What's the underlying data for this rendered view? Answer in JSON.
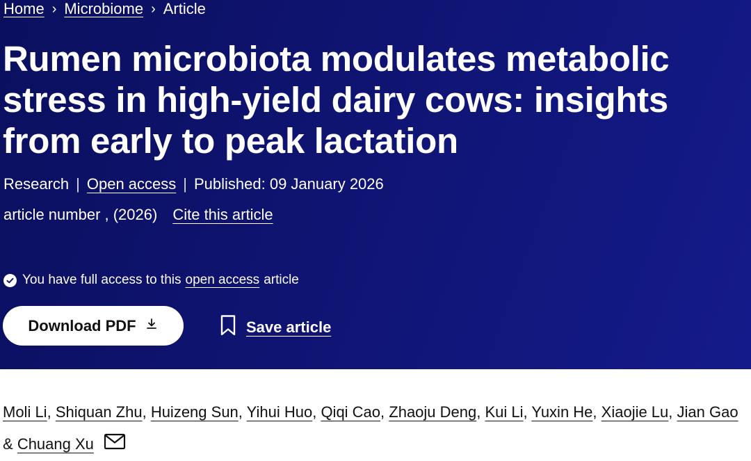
{
  "breadcrumb": {
    "items": [
      "Home",
      "Microbiome"
    ],
    "current": "Article",
    "separator": "›"
  },
  "article": {
    "title": "Rumen microbiota modulates metabolic stress in high-yield dairy cows: insights from early to peak lactation",
    "type": "Research",
    "access_label": "Open access",
    "published": "Published: 09 January 2026",
    "article_number": "article number , (2026)",
    "cite_label": "Cite this article"
  },
  "access_notice": {
    "prefix": "You have full access to this",
    "link": "open access",
    "suffix": "article"
  },
  "actions": {
    "download_label": "Download PDF",
    "save_label": "Save article"
  },
  "authors": {
    "names": [
      "Moli Li",
      "Shiquan Zhu",
      "Huizeng Sun",
      "Yihui Huo",
      "Qiqi Cao",
      "Zhaoju Deng",
      "Kui Li",
      "Yuxin He",
      "Xiaojie Lu",
      "Jian Gao"
    ],
    "last_prefix": "&",
    "last": "Chuang Xu"
  },
  "colors": {
    "hero_bg": "#0f1472",
    "text_on_hero": "#ffffff",
    "body_text": "#111111"
  },
  "icons": [
    "chevron-right-icon",
    "check-circle-icon",
    "download-icon",
    "bookmark-icon",
    "mail-icon"
  ]
}
